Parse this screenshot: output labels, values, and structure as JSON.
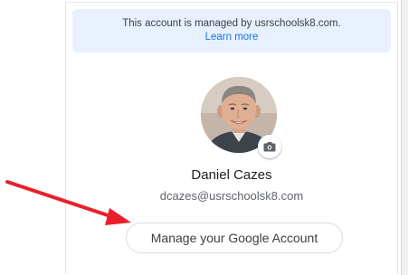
{
  "managed_banner": {
    "text": "This account is managed by usrschoolsk8.com.",
    "link": "Learn more"
  },
  "account": {
    "name": "Daniel Cazes",
    "email": "dcazes@usrschoolsk8.com",
    "avatar_icon": "profile-photo",
    "camera_icon": "camera-icon"
  },
  "manage_button": {
    "label": "Manage your Google Account"
  },
  "annotation": {
    "arrow_color": "#e8202a"
  },
  "colors": {
    "banner_bg": "#e8f0fe",
    "link": "#1a73e8"
  }
}
